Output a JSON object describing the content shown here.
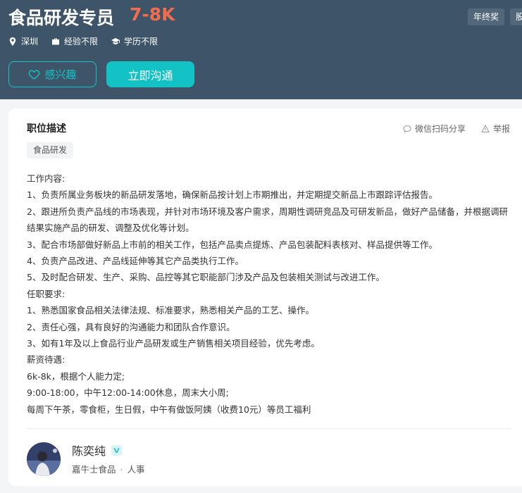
{
  "header": {
    "title": "食品研发专员",
    "salary": "7-8K",
    "tags": [
      "年终奖",
      "股票"
    ],
    "meta": {
      "location": "深圳",
      "experience": "经验不限",
      "education": "学历不限"
    },
    "interest_label": "感兴趣",
    "chat_label": "立即沟通"
  },
  "job": {
    "section_title": "职位描述",
    "share_label": "微信扫码分享",
    "report_label": "举报",
    "skill_tag": "食品研发",
    "description": [
      "工作内容:",
      "1、负责所属业务板块的新品研发落地，确保新品按计划上市期推出，并定期提交新品上市跟踪评估报告。",
      "2、跟进所负责产品线的市场表现，并针对市场环境及客户需求，周期性调研竞品及可研发新品，做好产品储备，并根据调研",
      "结果实施产品的研发、调整及优化等计划。",
      "3、配合市场部做好新品上市前的相关工作，包括产品卖点提炼、产品包装配料表核对、样品提供等工作。",
      "4、负责产品改进、产品线延伸等其它产品类执行工作。",
      "5、及时配合研发、生产、采购、品控等其它职能部门涉及产品及包装相关测试与改进工作。",
      "任职要求:",
      "1、熟悉国家食品相关法律法规、标准要求，熟悉相关产品的工艺、操作。",
      "2、责任心强，具有良好的沟通能力和团队合作意识。",
      "3、如有1年及以上食品行业产品研发或生产销售相关项目经验，优先考虑。",
      "薪资待遇:",
      "6k-8k，根据个人能力定;",
      "9:00-18:00，中午12:00-14:00休息，周末大小周;",
      "每周下午茶，零食柜，生日假，中午有做饭阿姨（收费10元）等员工福利"
    ]
  },
  "recruiter": {
    "name": "陈奕纯",
    "company": "嘉牛士食品",
    "separator": "·",
    "role": "人事"
  },
  "colors": {
    "header_bg": "#3e5569",
    "accent": "#12c2c5",
    "salary": "#f26d4d"
  }
}
